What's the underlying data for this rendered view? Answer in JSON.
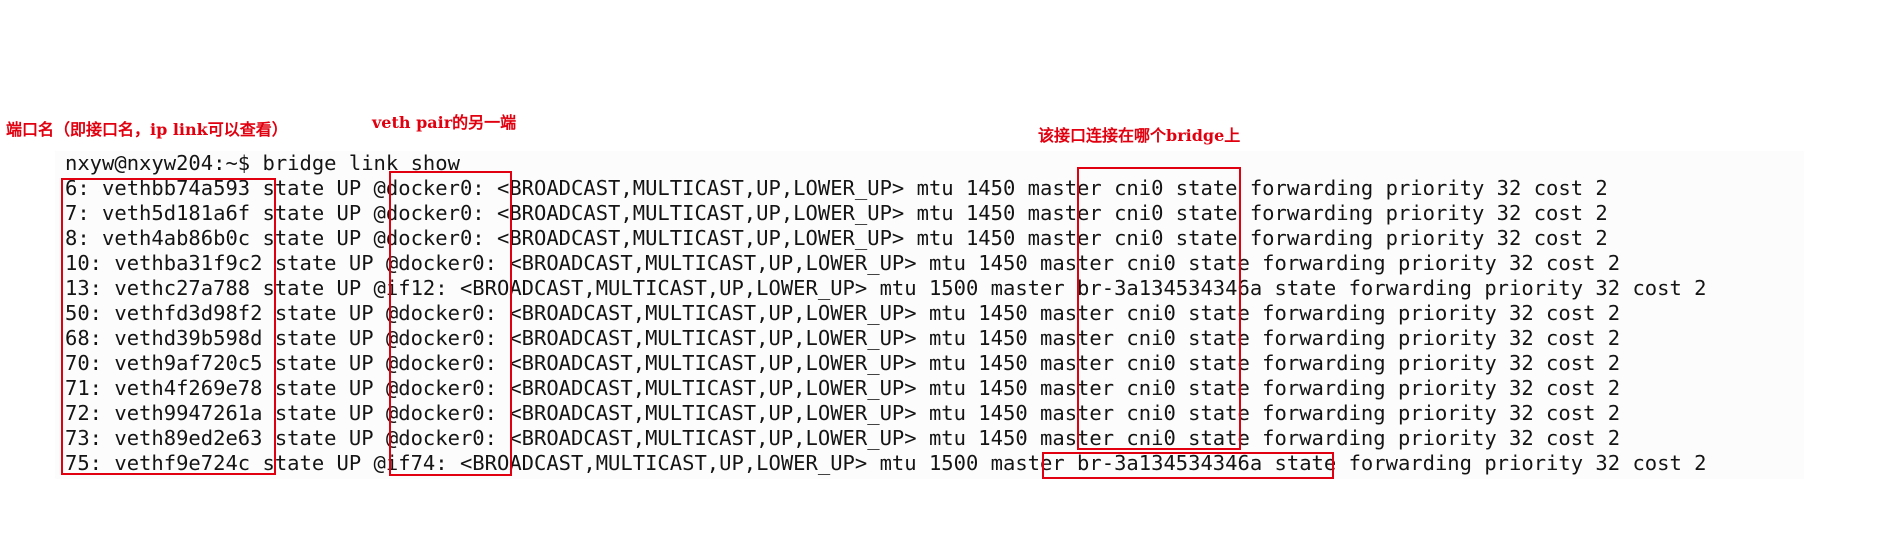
{
  "annotations": {
    "port_name": "端口名（即接口名，ip link可以查看）",
    "veth_peer": "veth pair的另一端",
    "bridge_master": "该接口连接在哪个bridge上"
  },
  "terminal": {
    "prompt": "nxyw@nxyw204:~$ bridge link show",
    "output_lines": [
      "6: vethbb74a593 state UP @docker0: <BROADCAST,MULTICAST,UP,LOWER_UP> mtu 1450 master cni0 state forwarding priority 32 cost 2",
      "7: veth5d181a6f state UP @docker0: <BROADCAST,MULTICAST,UP,LOWER_UP> mtu 1450 master cni0 state forwarding priority 32 cost 2",
      "8: veth4ab86b0c state UP @docker0: <BROADCAST,MULTICAST,UP,LOWER_UP> mtu 1450 master cni0 state forwarding priority 32 cost 2",
      "10: vethba31f9c2 state UP @docker0: <BROADCAST,MULTICAST,UP,LOWER_UP> mtu 1450 master cni0 state forwarding priority 32 cost 2",
      "13: vethc27a788 state UP @if12: <BROADCAST,MULTICAST,UP,LOWER_UP> mtu 1500 master br-3a134534346a state forwarding priority 32 cost 2",
      "50: vethfd3d98f2 state UP @docker0: <BROADCAST,MULTICAST,UP,LOWER_UP> mtu 1450 master cni0 state forwarding priority 32 cost 2",
      "68: vethd39b598d state UP @docker0: <BROADCAST,MULTICAST,UP,LOWER_UP> mtu 1450 master cni0 state forwarding priority 32 cost 2",
      "70: veth9af720c5 state UP @docker0: <BROADCAST,MULTICAST,UP,LOWER_UP> mtu 1450 master cni0 state forwarding priority 32 cost 2",
      "71: veth4f269e78 state UP @docker0: <BROADCAST,MULTICAST,UP,LOWER_UP> mtu 1450 master cni0 state forwarding priority 32 cost 2",
      "72: veth9947261a state UP @docker0: <BROADCAST,MULTICAST,UP,LOWER_UP> mtu 1450 master cni0 state forwarding priority 32 cost 2",
      "73: veth89ed2e63 state UP @docker0: <BROADCAST,MULTICAST,UP,LOWER_UP> mtu 1450 master cni0 state forwarding priority 32 cost 2",
      "75: vethf9e724c state UP @if74: <BROADCAST,MULTICAST,UP,LOWER_UP> mtu 1500 master br-3a134534346a state forwarding priority 32 cost 2"
    ]
  },
  "colors": {
    "annotation": "#e1000f",
    "terminal_text": "#141414",
    "terminal_bg": "#fcfcfc"
  }
}
